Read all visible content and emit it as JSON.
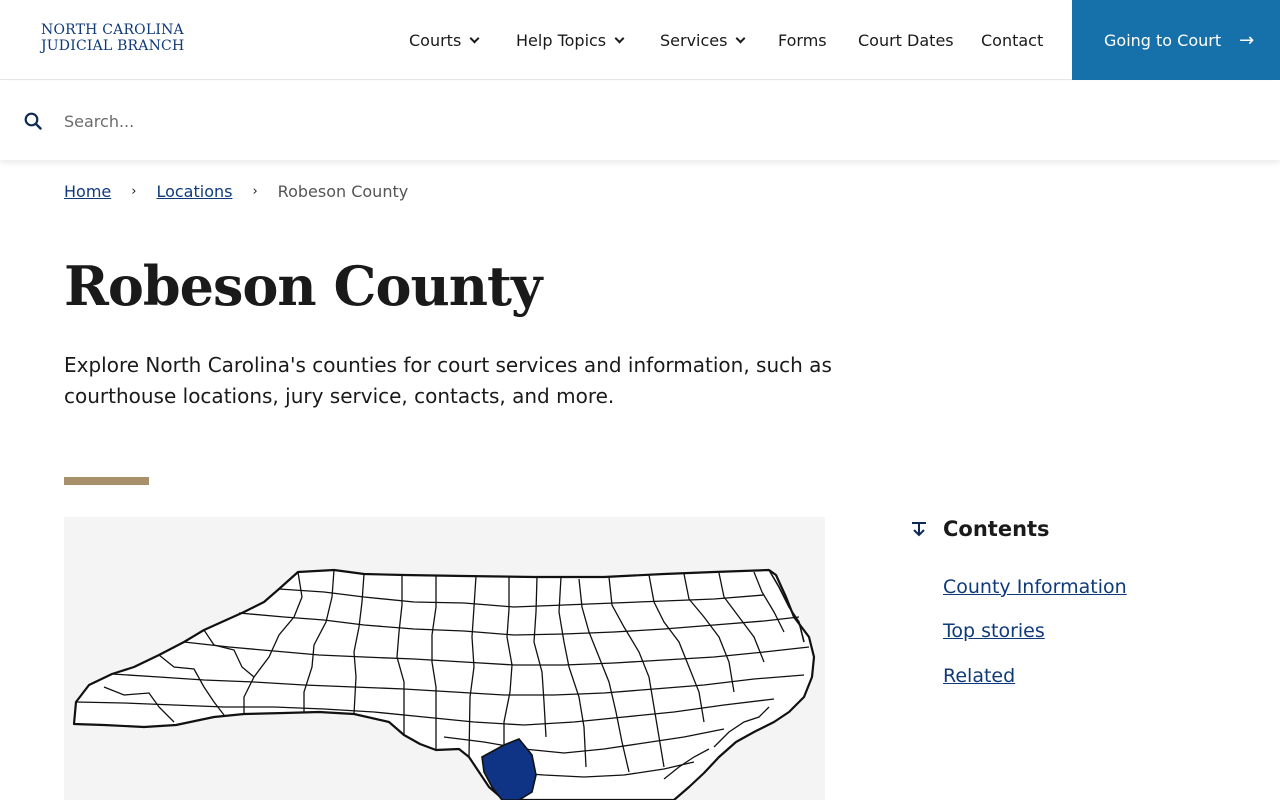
{
  "header": {
    "logo_line1": "NORTH CAROLINA",
    "logo_line2": "JUDICIAL BRANCH",
    "nav": [
      {
        "label": "Courts",
        "dropdown": true
      },
      {
        "label": "Help Topics",
        "dropdown": true
      },
      {
        "label": "Services",
        "dropdown": true
      },
      {
        "label": "Forms",
        "dropdown": false
      },
      {
        "label": "Court Dates",
        "dropdown": false
      },
      {
        "label": "Contact",
        "dropdown": false
      }
    ],
    "cta_label": "Going to Court",
    "cta_icon": "arrow-right-icon"
  },
  "search": {
    "placeholder": "Search...",
    "value": "",
    "icon": "search-icon"
  },
  "breadcrumb": {
    "items": [
      "Home",
      "Locations"
    ],
    "current": "Robeson County"
  },
  "page": {
    "title": "Robeson County",
    "description": "Explore North Carolina's counties for court services and information, such as courthouse locations, jury service, contacts, and more."
  },
  "map": {
    "highlight_color": "#0f3385",
    "highlighted_county": "Robeson County"
  },
  "contents": {
    "title": "Contents",
    "icon": "arrow-down-to-line-icon",
    "links": [
      "County Information",
      "Top stories",
      "Related"
    ]
  },
  "colors": {
    "brand_navy": "#0f3a7a",
    "cta_blue": "#1670a9",
    "accent_tan": "#a8916a"
  }
}
